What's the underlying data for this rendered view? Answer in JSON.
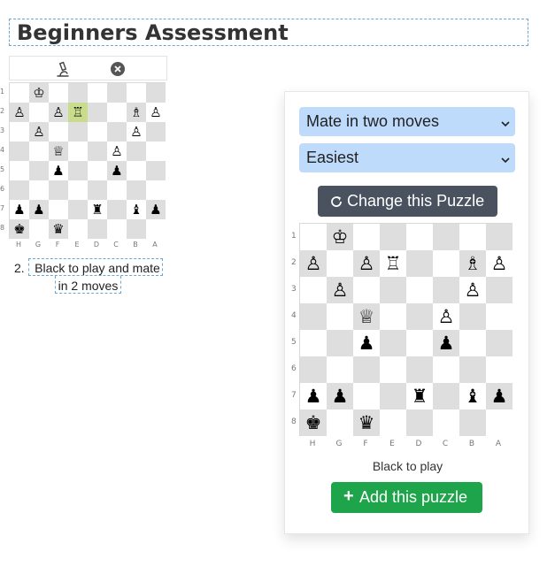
{
  "page": {
    "title": "Beginners Assessment"
  },
  "mini_toolbar": {
    "icons": [
      "microscope-icon",
      "close-circle-icon"
    ]
  },
  "board": {
    "files": [
      "H",
      "G",
      "F",
      "E",
      "D",
      "C",
      "B",
      "A"
    ],
    "ranks": [
      "1",
      "2",
      "3",
      "4",
      "5",
      "6",
      "7",
      "8"
    ],
    "pieces": [
      [
        "",
        "♔",
        "",
        "",
        "",
        "",
        "",
        ""
      ],
      [
        "♙",
        "",
        "♙",
        "♖",
        "",
        "",
        "♗",
        "♙"
      ],
      [
        "",
        "♙",
        "",
        "",
        "",
        "",
        "♙",
        ""
      ],
      [
        "",
        "",
        "♕",
        "",
        "",
        "♙",
        "",
        ""
      ],
      [
        "",
        "",
        "♟",
        "",
        "",
        "♟",
        "",
        ""
      ],
      [
        "",
        "",
        "",
        "",
        "",
        "",
        "",
        ""
      ],
      [
        "♟",
        "♟",
        "",
        "",
        "♜",
        "",
        "♝",
        "♟"
      ],
      [
        "♚",
        "",
        "♛",
        "",
        "",
        "",
        "",
        ""
      ]
    ],
    "highlight": {
      "rank": 1,
      "file": 3,
      "color": "#c8dc8c"
    }
  },
  "puzzle_item": {
    "number": "2.",
    "caption_line1": "Black to play and mate",
    "caption_line2": "in 2 moves"
  },
  "panel": {
    "puzzle_type": {
      "selected": "Mate in two moves"
    },
    "difficulty": {
      "selected": "Easiest"
    },
    "change_button": "Change this Puzzle",
    "to_play": "Black to play",
    "add_button": "Add this puzzle",
    "add_icon": "+"
  },
  "colors": {
    "select_bg": "#bfdbfc",
    "change_btn": "#4a5260",
    "add_btn": "#1ea44a",
    "dark_square": "#dedede",
    "light_square": "#ffffff"
  }
}
